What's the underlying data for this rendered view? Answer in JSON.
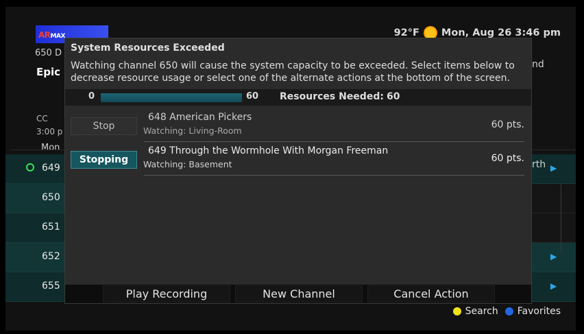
{
  "logo": {
    "text_red": "AR",
    "text_white": "MAX"
  },
  "topbar": {
    "temperature": "92°F",
    "weather_icon": "sun-icon",
    "datetime": "Mon, Aug 26 3:46 pm"
  },
  "background": {
    "channel_header": "650 D",
    "program_title": "Epic",
    "cc": "CC",
    "time": "3:00 p",
    "day": "Mon",
    "right_text_1": "nd",
    "right_text_2": "rth",
    "rows": [
      {
        "channel": "649",
        "has_clock": true,
        "arrow": true
      },
      {
        "channel": "650",
        "has_clock": false,
        "arrow": false
      },
      {
        "channel": "651",
        "has_clock": false,
        "arrow": false
      },
      {
        "channel": "652",
        "has_clock": false,
        "arrow": true
      },
      {
        "channel": "655",
        "has_clock": false,
        "arrow": true
      }
    ]
  },
  "legend": {
    "search_label": "Search",
    "favorites_label": "Favorites",
    "search_color": "#f0e21c",
    "favorites_color": "#2466e0"
  },
  "dialog": {
    "title": "System Resources Exceeded",
    "message": "Watching channel 650 will cause the system capacity to be exceeded. Select items below to decrease resource usage or select one of the alternate actions at the bottom of the screen.",
    "resources": {
      "min_label": "0",
      "max_label": "60",
      "needed_label": "Resources Needed:",
      "needed_value": "60",
      "fill_percent": 100
    },
    "items": [
      {
        "button_label": "Stop",
        "state": "idle",
        "title": "648  American Pickers",
        "location": "Watching: Living-Room",
        "points": "60 pts."
      },
      {
        "button_label": "Stopping",
        "state": "active",
        "title": "649  Through the Wormhole With Morgan Freeman",
        "location": "Watching: Basement",
        "points": "60 pts."
      }
    ],
    "actions": {
      "play_recording": "Play Recording",
      "new_channel": "New Channel",
      "cancel_action": "Cancel Action"
    }
  }
}
